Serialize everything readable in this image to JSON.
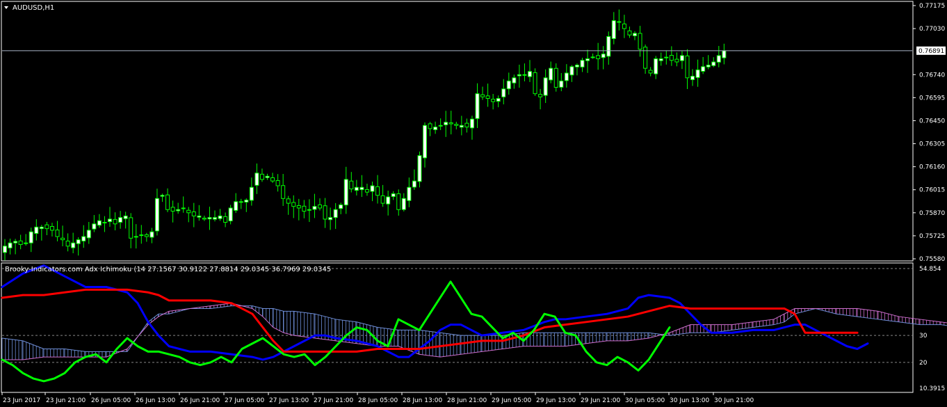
{
  "window": {
    "symbol_title": "AUDUSD,H1",
    "indicator_title": "Brooky-Indicators.com Adx Ichimoku (14 27.1567 30.9122 27.8814 29.0345 36.7969 29.0345",
    "current_price_label": "0.76891"
  },
  "colors": {
    "background": "#000000",
    "axis": "#ffffff",
    "bull_candle": "#ffffff",
    "bear_candle": "#000000",
    "candle_outline": "#00ff00",
    "price_line": "#aab4c8",
    "tenkan": "#0000ff",
    "kijun": "#ff0000",
    "chikou": "#00ff00",
    "cloud_up": "#6f8fd9",
    "cloud_down": "#d06fd0",
    "level_line": "#888888"
  },
  "chart_data": [
    {
      "type": "candlestick",
      "title": "AUDUSD,H1",
      "ylim": [
        0.7558,
        0.77175
      ],
      "y_ticks": [
        "0.77175",
        "0.77030",
        "0.76740",
        "0.76595",
        "0.76450",
        "0.76305",
        "0.76160",
        "0.76015",
        "0.75870",
        "0.75725",
        "0.75580"
      ],
      "x_tick_labels": [
        "23 Jun 2017",
        "23 Jun 21:00",
        "26 Jun 05:00",
        "26 Jun 13:00",
        "26 Jun 21:00",
        "27 Jun 05:00",
        "27 Jun 13:00",
        "27 Jun 21:00",
        "28 Jun 05:00",
        "28 Jun 13:00",
        "28 Jun 21:00",
        "29 Jun 05:00",
        "29 Jun 13:00",
        "29 Jun 21:00",
        "30 Jun 05:00",
        "30 Jun 13:00",
        "30 Jun 21:00"
      ],
      "current_price": 0.76891,
      "close_series": [
        0.7566,
        0.7568,
        0.7569,
        0.7567,
        0.7568,
        0.7575,
        0.7578,
        0.7578,
        0.7577,
        0.7576,
        0.7572,
        0.757,
        0.7566,
        0.7568,
        0.757,
        0.7572,
        0.7576,
        0.758,
        0.7582,
        0.7581,
        0.7583,
        0.758,
        0.7584,
        0.7585,
        0.7571,
        0.7572,
        0.7573,
        0.7572,
        0.7575,
        0.7596,
        0.7598,
        0.7589,
        0.7588,
        0.7589,
        0.759,
        0.7587,
        0.7585,
        0.7585,
        0.7583,
        0.7584,
        0.7584,
        0.7585,
        0.7581,
        0.759,
        0.7594,
        0.7594,
        0.7595,
        0.7603,
        0.7612,
        0.7608,
        0.761,
        0.7607,
        0.7604,
        0.7596,
        0.7593,
        0.7591,
        0.759,
        0.7588,
        0.7589,
        0.7591,
        0.759,
        0.7583,
        0.7584,
        0.7589,
        0.7592,
        0.7608,
        0.7602,
        0.7603,
        0.7603,
        0.76,
        0.7604,
        0.7598,
        0.7593,
        0.7597,
        0.7599,
        0.7589,
        0.7596,
        0.7603,
        0.7607,
        0.7623,
        0.7642,
        0.764,
        0.7641,
        0.7642,
        0.7644,
        0.7643,
        0.7642,
        0.7642,
        0.7641,
        0.7646,
        0.7662,
        0.766,
        0.7659,
        0.7657,
        0.7659,
        0.7665,
        0.767,
        0.7672,
        0.7674,
        0.7674,
        0.7676,
        0.7662,
        0.766,
        0.7672,
        0.7678,
        0.7666,
        0.767,
        0.7675,
        0.7679,
        0.768,
        0.7683,
        0.7684,
        0.7685,
        0.7684,
        0.7687,
        0.7698,
        0.7708,
        0.7707,
        0.7703,
        0.7699,
        0.77,
        0.769,
        0.7678,
        0.7675,
        0.7684,
        0.7684,
        0.7685,
        0.7683,
        0.7682,
        0.7686,
        0.7672,
        0.7673,
        0.7677,
        0.7679,
        0.768,
        0.7682,
        0.7686,
        0.7689
      ]
    },
    {
      "type": "line",
      "title": "Brooky-Indicators.com Adx Ichimoku (14 27.1567 30.9122 27.8814 29.0345 36.7969 29.0345",
      "ylim": [
        10.3915,
        54.854
      ],
      "y_ticks": [
        "54.854",
        "30",
        "20",
        "10.3915"
      ],
      "levels": [
        30,
        20
      ],
      "series": [
        {
          "name": "tenkan",
          "points": [
            [
              0,
              48
            ],
            [
              10,
              53
            ],
            [
              20,
              56
            ],
            [
              30,
              52
            ],
            [
              40,
              48
            ],
            [
              50,
              48
            ],
            [
              60,
              46
            ],
            [
              65,
              42
            ],
            [
              70,
              35
            ],
            [
              75,
              30
            ],
            [
              80,
              26
            ],
            [
              85,
              25
            ],
            [
              90,
              24
            ],
            [
              95,
              24
            ],
            [
              100,
              24
            ],
            [
              110,
              23
            ],
            [
              120,
              22
            ],
            [
              125,
              21
            ],
            [
              130,
              22
            ],
            [
              135,
              24
            ],
            [
              140,
              26
            ],
            [
              145,
              28
            ],
            [
              150,
              30
            ],
            [
              155,
              30
            ],
            [
              160,
              29
            ],
            [
              170,
              28
            ],
            [
              175,
              27
            ],
            [
              180,
              26
            ],
            [
              185,
              24
            ],
            [
              190,
              22
            ],
            [
              195,
              22
            ],
            [
              200,
              25
            ],
            [
              205,
              28
            ],
            [
              210,
              32
            ],
            [
              215,
              34
            ],
            [
              220,
              34
            ],
            [
              230,
              30
            ],
            [
              240,
              31
            ],
            [
              250,
              32
            ],
            [
              260,
              35
            ],
            [
              265,
              36
            ],
            [
              270,
              36
            ],
            [
              280,
              37
            ],
            [
              290,
              38
            ],
            [
              300,
              40
            ],
            [
              305,
              44
            ],
            [
              310,
              45
            ],
            [
              320,
              44
            ],
            [
              325,
              42
            ],
            [
              330,
              38
            ],
            [
              335,
              34
            ],
            [
              340,
              31
            ],
            [
              350,
              31
            ],
            [
              360,
              32
            ],
            [
              370,
              32
            ],
            [
              380,
              34
            ],
            [
              385,
              34
            ],
            [
              390,
              32
            ],
            [
              395,
              30
            ],
            [
              400,
              28
            ],
            [
              405,
              26
            ],
            [
              410,
              25
            ],
            [
              415,
              27
            ]
          ]
        },
        {
          "name": "kijun",
          "points": [
            [
              0,
              44
            ],
            [
              10,
              45
            ],
            [
              20,
              45
            ],
            [
              30,
              46
            ],
            [
              40,
              47
            ],
            [
              50,
              47
            ],
            [
              60,
              47
            ],
            [
              70,
              46
            ],
            [
              75,
              45
            ],
            [
              80,
              43
            ],
            [
              90,
              43
            ],
            [
              100,
              43
            ],
            [
              110,
              42
            ],
            [
              120,
              38
            ],
            [
              125,
              33
            ],
            [
              130,
              28
            ],
            [
              135,
              24
            ],
            [
              140,
              24
            ],
            [
              150,
              24
            ],
            [
              160,
              24
            ],
            [
              170,
              24
            ],
            [
              180,
              25
            ],
            [
              190,
              25
            ],
            [
              200,
              25
            ],
            [
              210,
              26
            ],
            [
              220,
              27
            ],
            [
              230,
              28
            ],
            [
              240,
              28
            ],
            [
              250,
              30
            ],
            [
              260,
              33
            ],
            [
              270,
              34
            ],
            [
              280,
              35
            ],
            [
              290,
              36
            ],
            [
              300,
              37
            ],
            [
              305,
              38
            ],
            [
              310,
              39
            ],
            [
              315,
              40
            ],
            [
              320,
              41
            ],
            [
              330,
              40
            ],
            [
              340,
              40
            ],
            [
              350,
              40
            ],
            [
              360,
              40
            ],
            [
              370,
              40
            ],
            [
              375,
              40
            ],
            [
              380,
              38
            ],
            [
              385,
              31
            ],
            [
              390,
              31
            ],
            [
              400,
              31
            ],
            [
              410,
              31
            ]
          ]
        },
        {
          "name": "chikou",
          "points": [
            [
              0,
              21
            ],
            [
              5,
              19
            ],
            [
              10,
              16
            ],
            [
              15,
              14
            ],
            [
              20,
              13
            ],
            [
              25,
              14
            ],
            [
              30,
              16
            ],
            [
              35,
              20
            ],
            [
              40,
              22
            ],
            [
              45,
              23
            ],
            [
              50,
              20
            ],
            [
              55,
              25
            ],
            [
              60,
              29
            ],
            [
              65,
              26
            ],
            [
              70,
              24
            ],
            [
              75,
              24
            ],
            [
              80,
              23
            ],
            [
              85,
              22
            ],
            [
              90,
              20
            ],
            [
              95,
              19
            ],
            [
              100,
              20
            ],
            [
              105,
              22
            ],
            [
              110,
              20
            ],
            [
              115,
              25
            ],
            [
              120,
              27
            ],
            [
              125,
              29
            ],
            [
              130,
              26
            ],
            [
              135,
              23
            ],
            [
              140,
              22
            ],
            [
              145,
              23
            ],
            [
              150,
              19
            ],
            [
              155,
              22
            ],
            [
              160,
              26
            ],
            [
              165,
              30
            ],
            [
              170,
              33
            ],
            [
              175,
              32
            ],
            [
              180,
              28
            ],
            [
              185,
              26
            ],
            [
              190,
              36
            ],
            [
              195,
              34
            ],
            [
              200,
              32
            ],
            [
              205,
              38
            ],
            [
              210,
              44
            ],
            [
              215,
              50
            ],
            [
              220,
              44
            ],
            [
              225,
              38
            ],
            [
              230,
              37
            ],
            [
              235,
              33
            ],
            [
              240,
              29
            ],
            [
              245,
              31
            ],
            [
              250,
              28
            ],
            [
              255,
              32
            ],
            [
              260,
              38
            ],
            [
              265,
              37
            ],
            [
              270,
              31
            ],
            [
              275,
              30
            ],
            [
              280,
              24
            ],
            [
              285,
              20
            ],
            [
              290,
              19
            ],
            [
              295,
              22
            ],
            [
              300,
              20
            ],
            [
              305,
              17
            ],
            [
              310,
              21
            ],
            [
              315,
              27
            ],
            [
              320,
              33
            ]
          ]
        }
      ],
      "cloud": [
        [
          0,
          29,
          21
        ],
        [
          10,
          28,
          21
        ],
        [
          20,
          25,
          22
        ],
        [
          30,
          25,
          22
        ],
        [
          40,
          24,
          22
        ],
        [
          50,
          24,
          22
        ],
        [
          60,
          24,
          25
        ],
        [
          70,
          35,
          34
        ],
        [
          75,
          38,
          37
        ],
        [
          80,
          38,
          39
        ],
        [
          90,
          40,
          40
        ],
        [
          100,
          40,
          41
        ],
        [
          110,
          41,
          42
        ],
        [
          120,
          41,
          40
        ],
        [
          125,
          40,
          37
        ],
        [
          130,
          40,
          33
        ],
        [
          135,
          39,
          31
        ],
        [
          140,
          39,
          30
        ],
        [
          150,
          38,
          29
        ],
        [
          160,
          36,
          28
        ],
        [
          170,
          35,
          27
        ],
        [
          180,
          33,
          26
        ],
        [
          190,
          32,
          26
        ],
        [
          200,
          32,
          23
        ],
        [
          210,
          31,
          22
        ],
        [
          220,
          30,
          23
        ],
        [
          230,
          30,
          24
        ],
        [
          240,
          30,
          25
        ],
        [
          250,
          31,
          26
        ],
        [
          260,
          31,
          26
        ],
        [
          270,
          31,
          26
        ],
        [
          280,
          31,
          27
        ],
        [
          290,
          31,
          28
        ],
        [
          300,
          31,
          28
        ],
        [
          310,
          31,
          29
        ],
        [
          320,
          30,
          31
        ],
        [
          330,
          31,
          34
        ],
        [
          340,
          31,
          34
        ],
        [
          350,
          32,
          34
        ],
        [
          360,
          33,
          35
        ],
        [
          370,
          34,
          36
        ],
        [
          375,
          35,
          38
        ],
        [
          380,
          38,
          40
        ],
        [
          390,
          40,
          40
        ],
        [
          400,
          38,
          40
        ],
        [
          410,
          37,
          40
        ],
        [
          420,
          36,
          39
        ],
        [
          430,
          35,
          37
        ],
        [
          440,
          34,
          36
        ],
        [
          450,
          34,
          35
        ],
        [
          460,
          33,
          34
        ],
        [
          470,
          33,
          32
        ],
        [
          480,
          33,
          31
        ],
        [
          490,
          33,
          30
        ],
        [
          500,
          33,
          29
        ],
        [
          510,
          33,
          28
        ],
        [
          515,
          33,
          29
        ]
      ]
    }
  ]
}
